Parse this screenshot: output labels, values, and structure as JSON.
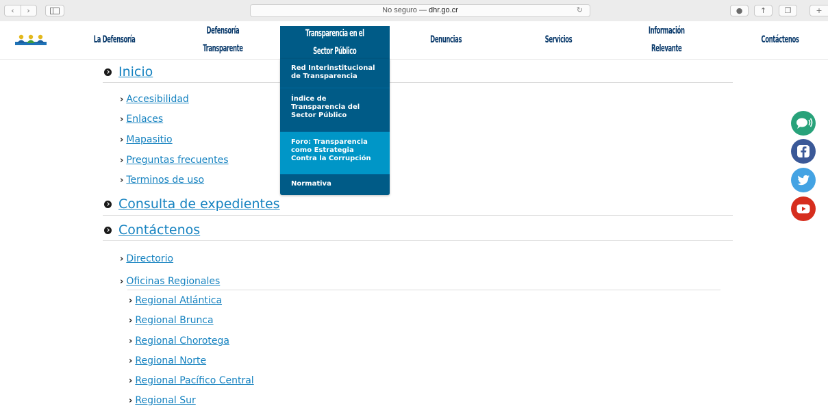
{
  "browser": {
    "url_prefix": "No seguro — ",
    "url_domain": "dhr.go.cr",
    "back_icon": "chevron-left-icon",
    "forward_icon": "chevron-right-icon"
  },
  "nav": {
    "items": [
      {
        "line1": "La Defensoría",
        "line2": ""
      },
      {
        "line1": "Defensoría",
        "line2": "Transparente"
      },
      {
        "line1": "Transparencia en el",
        "line2": "Sector Público"
      },
      {
        "line1": "Denuncias",
        "line2": ""
      },
      {
        "line1": "Servicios",
        "line2": ""
      },
      {
        "line1": "Información",
        "line2": "Relevante"
      },
      {
        "line1": "Contáctenos",
        "line2": ""
      }
    ],
    "active_color": "#005b87",
    "text_color": "#0a3a6b"
  },
  "dropdown": {
    "items": [
      {
        "line1": "Red Interinstitucional",
        "line2": "de Transparencia",
        "line3": ""
      },
      {
        "line1": "Índice de",
        "line2": "Transparencia del",
        "line3": "Sector Público"
      },
      {
        "line1": "Foro: Transparencia",
        "line2": "como Estrategia",
        "line3": "Contra la Corrupción"
      },
      {
        "line1": "Normativa",
        "line2": "",
        "line3": ""
      }
    ],
    "highlight_color": "#0096c7"
  },
  "sitemap": {
    "sections": [
      {
        "label": "Inicio"
      },
      {
        "label": "Consulta de expedientes"
      },
      {
        "label": "Contáctenos"
      }
    ],
    "inicio_links": [
      "Accesibilidad",
      "Enlaces",
      "Mapasitio",
      "Preguntas frecuentes",
      "Terminos de uso"
    ],
    "contacto_links": [
      "Directorio",
      "Oficinas Regionales"
    ],
    "regional_links": [
      "Regional Atlántica",
      "Regional Brunca",
      "Regional Chorotega",
      "Regional Norte",
      "Regional Pacífico Central",
      "Regional Sur"
    ],
    "link_color": "#1582c0"
  },
  "social": {
    "icons": [
      "chat-icon",
      "facebook-icon",
      "twitter-icon",
      "youtube-icon"
    ]
  }
}
